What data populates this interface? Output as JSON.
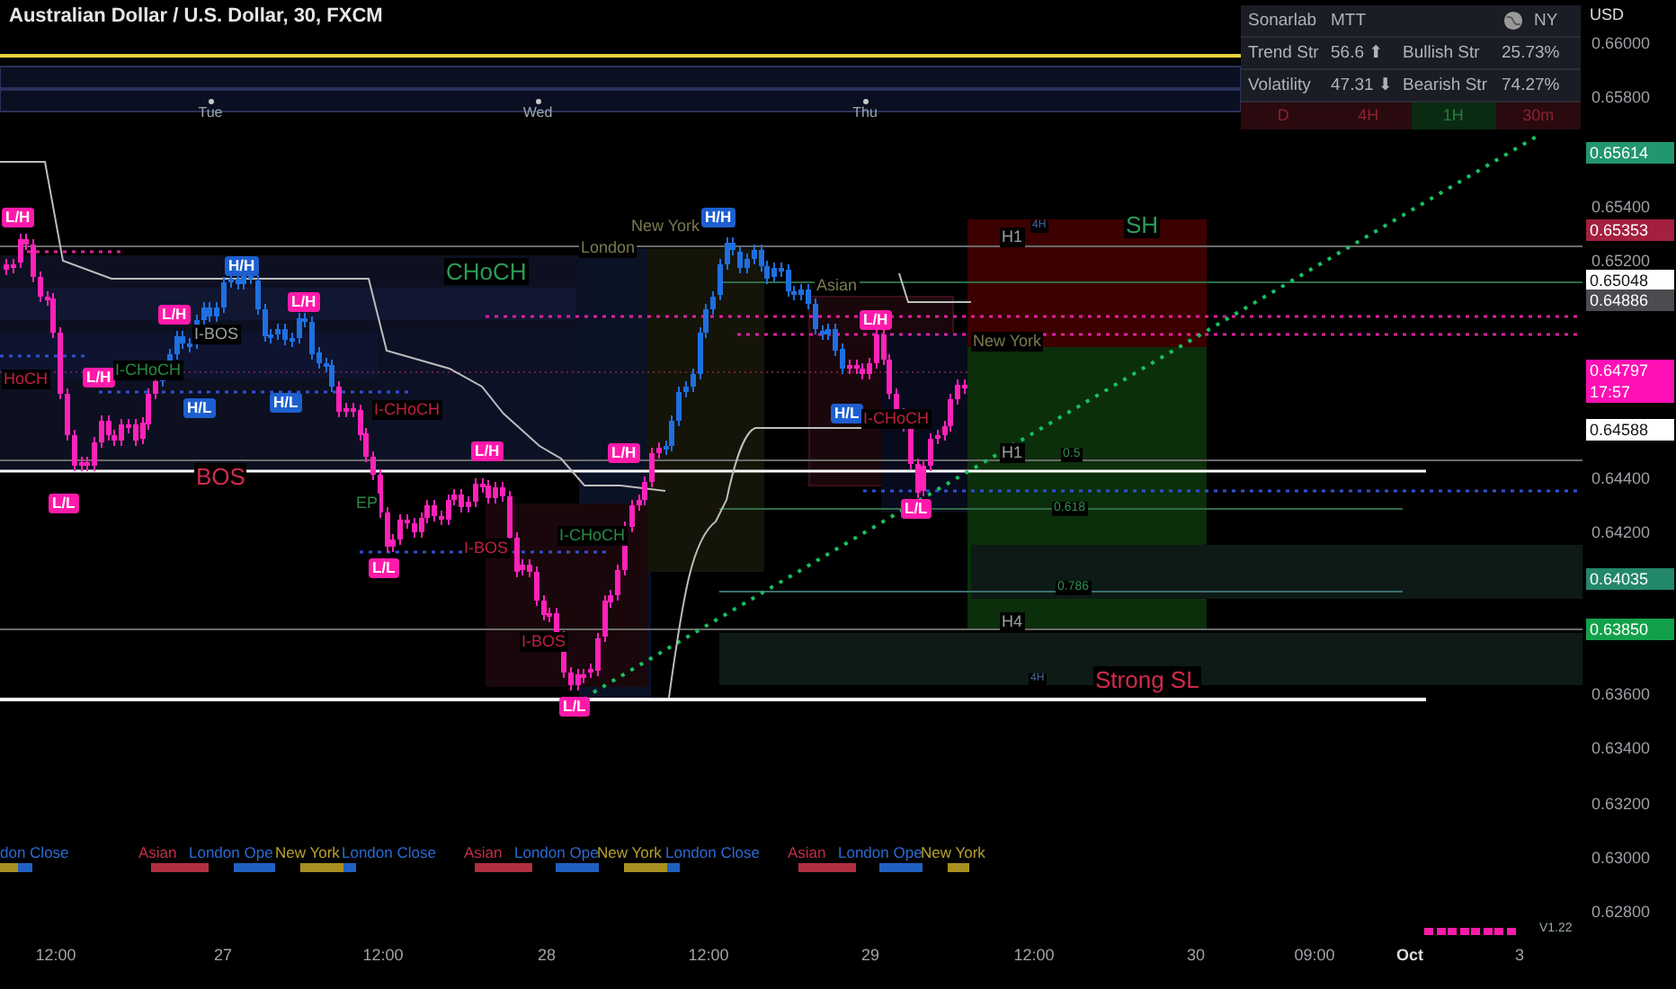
{
  "title": "Australian Dollar / U.S. Dollar, 30, FXCM",
  "currency": "USD",
  "dashboard": {
    "name": "Sonarlab",
    "mode": "MTT",
    "session": "NY",
    "stats": [
      {
        "label": "Trend Str",
        "value": "56.6 ⬆",
        "side_label": "Bullish Str",
        "side_value": "25.73%"
      },
      {
        "label": "Volatility",
        "value": "47.31 ⬇",
        "side_label": "Bearish Str",
        "side_value": "74.27%"
      }
    ],
    "timeframes": [
      {
        "label": "D",
        "color": "#2a0a0e"
      },
      {
        "label": "4H",
        "color": "#2a0a0e"
      },
      {
        "label": "1H",
        "color": "#0b2a12"
      },
      {
        "label": "30m",
        "color": "#2a0a0e"
      }
    ]
  },
  "day_labels": [
    "Tue",
    "Wed",
    "Thu"
  ],
  "chart_labels": [
    {
      "text": "L/H",
      "kind": "tag_pink"
    },
    {
      "text": "H/H",
      "kind": "tag_blue"
    },
    {
      "text": "L/H",
      "kind": "tag_pink"
    },
    {
      "text": "L/H",
      "kind": "tag_pink"
    },
    {
      "text": "I-BOS",
      "kind": "text_grey"
    },
    {
      "text": "L/H",
      "kind": "tag_pink"
    },
    {
      "text": "I-CHoCH",
      "kind": "text_green"
    },
    {
      "text": "HoCH",
      "kind": "text_red"
    },
    {
      "text": "H/L",
      "kind": "tag_blue"
    },
    {
      "text": "H/L",
      "kind": "tag_blue"
    },
    {
      "text": "I-CHoCH",
      "kind": "text_red"
    },
    {
      "text": "BOS",
      "kind": "big_red"
    },
    {
      "text": "L/L",
      "kind": "tag_pink"
    },
    {
      "text": "L/H",
      "kind": "tag_pink"
    },
    {
      "text": "L/H",
      "kind": "tag_pink"
    },
    {
      "text": "EP",
      "kind": "text_green"
    },
    {
      "text": "L/L",
      "kind": "tag_pink"
    },
    {
      "text": "I-BOS",
      "kind": "text_red"
    },
    {
      "text": "I-CHoCH",
      "kind": "text_green"
    },
    {
      "text": "I-BOS",
      "kind": "text_red"
    },
    {
      "text": "L/L",
      "kind": "tag_pink"
    },
    {
      "text": "CHoCH",
      "kind": "big_green"
    },
    {
      "text": "New York",
      "kind": "text_faint"
    },
    {
      "text": "H/H",
      "kind": "tag_blue"
    },
    {
      "text": "H1",
      "kind": "text_grey"
    },
    {
      "text": "4H",
      "kind": "text_tiny"
    },
    {
      "text": "SH",
      "kind": "big_green"
    },
    {
      "text": "Asian",
      "kind": "text_faint"
    },
    {
      "text": "L/H",
      "kind": "tag_pink"
    },
    {
      "text": "New York",
      "kind": "text_faint"
    },
    {
      "text": "H/L",
      "kind": "tag_blue"
    },
    {
      "text": "I-CHoCH",
      "kind": "text_red"
    },
    {
      "text": "H1",
      "kind": "text_grey"
    },
    {
      "text": "0.5",
      "kind": "text_fib"
    },
    {
      "text": "L/L",
      "kind": "tag_pink"
    },
    {
      "text": "0.618",
      "kind": "text_fib"
    },
    {
      "text": "0.786",
      "kind": "text_fib"
    },
    {
      "text": "H4",
      "kind": "text_grey"
    },
    {
      "text": "4H",
      "kind": "text_tiny"
    },
    {
      "text": "Strong SL",
      "kind": "big_red"
    },
    {
      "text": "London",
      "kind": "text_faint"
    }
  ],
  "sessions": [
    {
      "text": "don Close",
      "kind": "london_close"
    },
    {
      "text": "Asian",
      "kind": "asian"
    },
    {
      "text": "London Ope",
      "kind": "london_open"
    },
    {
      "text": "New York",
      "kind": "new_york"
    },
    {
      "text": "London Close",
      "kind": "london_close"
    },
    {
      "text": "Asian",
      "kind": "asian"
    },
    {
      "text": "London Ope",
      "kind": "london_open"
    },
    {
      "text": "New York",
      "kind": "new_york"
    },
    {
      "text": "London Close",
      "kind": "london_close"
    },
    {
      "text": "Asian",
      "kind": "asian"
    },
    {
      "text": "London Ope",
      "kind": "london_open"
    },
    {
      "text": "New York",
      "kind": "new_york"
    }
  ],
  "version": "V1.22",
  "price_ticks": [
    "0.66000",
    "0.65800",
    "0.65400",
    "0.65200",
    "0.64400",
    "0.64200",
    "0.63600",
    "0.63400",
    "0.63200",
    "0.63000",
    "0.62800"
  ],
  "price_tags": [
    {
      "text": "0.65614",
      "color": "#22966e"
    },
    {
      "text": "0.65353",
      "color": "#a3203e"
    },
    {
      "text": "0.65048",
      "color": "#ffffff"
    },
    {
      "text": "0.64886",
      "color": "#4a4c50"
    },
    {
      "text": "0.64797",
      "color": "#ff10b4",
      "countdown": "17:57"
    },
    {
      "text": "0.64588",
      "color": "#ffffff"
    },
    {
      "text": "0.64035",
      "color": "#23876a"
    },
    {
      "text": "0.63850",
      "color": "#12a14a"
    }
  ],
  "time_labels": [
    {
      "text": "12:00",
      "kind": "time"
    },
    {
      "text": "27",
      "kind": "day"
    },
    {
      "text": "12:00",
      "kind": "time"
    },
    {
      "text": "28",
      "kind": "day"
    },
    {
      "text": "12:00",
      "kind": "time"
    },
    {
      "text": "29",
      "kind": "day"
    },
    {
      "text": "12:00",
      "kind": "time"
    },
    {
      "text": "30",
      "kind": "day"
    },
    {
      "text": "09:00",
      "kind": "time"
    },
    {
      "text": "Oct",
      "kind": "month"
    },
    {
      "text": "3",
      "kind": "day"
    }
  ]
}
